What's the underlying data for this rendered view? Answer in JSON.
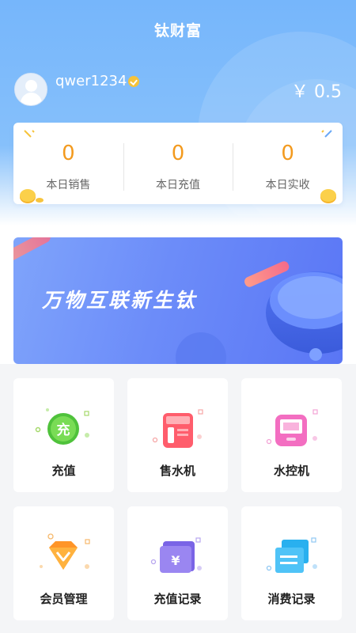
{
  "header": {
    "title": "钛财富"
  },
  "user": {
    "name": "qwer1234",
    "balance": "￥ 0.5"
  },
  "stats": [
    {
      "value": "0",
      "label": "本日销售"
    },
    {
      "value": "0",
      "label": "本日充值"
    },
    {
      "value": "0",
      "label": "本日实收"
    }
  ],
  "banner": {
    "text": "万物互联新生钛"
  },
  "menu": [
    {
      "label": "充值",
      "icon": "recharge-icon",
      "icon_text": "充"
    },
    {
      "label": "售水机",
      "icon": "water-vending-machine-icon"
    },
    {
      "label": "水控机",
      "icon": "water-control-machine-icon"
    },
    {
      "label": "会员管理",
      "icon": "member-diamond-icon"
    },
    {
      "label": "充值记录",
      "icon": "recharge-record-icon",
      "icon_text": "¥"
    },
    {
      "label": "消费记录",
      "icon": "consumption-record-icon"
    }
  ],
  "colors": {
    "accent": "#f39a1e",
    "primary": "#76b6fb"
  }
}
